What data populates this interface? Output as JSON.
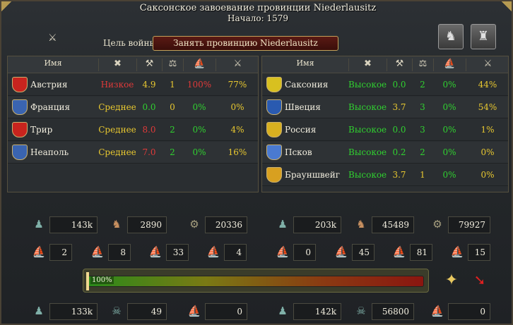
{
  "header": {
    "title": "Саксонское завоевание провинции Niederlausitz",
    "start": "Начало: 1579"
  },
  "war_goal": {
    "label": "Цель войны",
    "value": "Занять провинцию Niederlausitz"
  },
  "icons": {
    "crossed_swords": "crossed-swords-icon",
    "leaders": "leaders-icon",
    "advisors": "advisors-icon"
  },
  "table_headers": {
    "name": "Имя",
    "col2": "✖",
    "col3": "⚒",
    "col4": "⚖",
    "col5": "⛵",
    "col6": "⚔"
  },
  "attackers": [
    {
      "name": "Австрия",
      "status": "Низкое",
      "status_color": "r",
      "c1": "4.9",
      "c1_color": "y",
      "c2": "1",
      "c2_color": "y",
      "c3": "100%",
      "c3_color": "r",
      "c4": "77%",
      "c4_color": "y",
      "flag": "#c8241e"
    },
    {
      "name": "Франция",
      "status": "Среднее",
      "status_color": "y",
      "c1": "0.0",
      "c1_color": "g",
      "c2": "0",
      "c2_color": "y",
      "c3": "0%",
      "c3_color": "g",
      "c4": "0%",
      "c4_color": "y",
      "flag": "#3a64b0"
    },
    {
      "name": "Трир",
      "status": "Среднее",
      "status_color": "y",
      "c1": "8.0",
      "c1_color": "r",
      "c2": "2",
      "c2_color": "g",
      "c3": "0%",
      "c3_color": "g",
      "c4": "4%",
      "c4_color": "y",
      "flag": "#c8241e"
    },
    {
      "name": "Неаполь",
      "status": "Среднее",
      "status_color": "y",
      "c1": "7.0",
      "c1_color": "r",
      "c2": "2",
      "c2_color": "g",
      "c3": "0%",
      "c3_color": "g",
      "c4": "16%",
      "c4_color": "y",
      "flag": "#3a64b0"
    }
  ],
  "defenders": [
    {
      "name": "Саксония",
      "status": "Высокое",
      "status_color": "g",
      "c1": "0.0",
      "c1_color": "g",
      "c2": "2",
      "c2_color": "g",
      "c3": "0%",
      "c3_color": "g",
      "c4": "44%",
      "c4_color": "y",
      "flag": "#d8c020"
    },
    {
      "name": "Швеция",
      "status": "Высокое",
      "status_color": "g",
      "c1": "3.7",
      "c1_color": "y",
      "c2": "3",
      "c2_color": "g",
      "c3": "0%",
      "c3_color": "g",
      "c4": "54%",
      "c4_color": "y",
      "flag": "#2a5ab0"
    },
    {
      "name": "Россия",
      "status": "Высокое",
      "status_color": "g",
      "c1": "0.0",
      "c1_color": "g",
      "c2": "3",
      "c2_color": "g",
      "c3": "0%",
      "c3_color": "g",
      "c4": "1%",
      "c4_color": "y",
      "flag": "#d8b020"
    },
    {
      "name": "Псков",
      "status": "Высокое",
      "status_color": "g",
      "c1": "0.2",
      "c1_color": "g",
      "c2": "2",
      "c2_color": "g",
      "c3": "0%",
      "c3_color": "g",
      "c4": "0%",
      "c4_color": "y",
      "flag": "#4a7ad0"
    },
    {
      "name": "Брауншвейг",
      "status": "Высокое",
      "status_color": "g",
      "c1": "3.7",
      "c1_color": "y",
      "c2": "1",
      "c2_color": "y",
      "c3": "0%",
      "c3_color": "g",
      "c4": "0%",
      "c4_color": "y",
      "flag": "#d8a020"
    }
  ],
  "attacker_forces": {
    "infantry": "143k",
    "cavalry": "2890",
    "artillery": "20336",
    "heavy_ships": "2",
    "light_ships": "8",
    "galleys": "33",
    "transports": "4"
  },
  "defender_forces": {
    "infantry": "203k",
    "cavalry": "45489",
    "artillery": "79927",
    "heavy_ships": "0",
    "light_ships": "45",
    "galleys": "81",
    "transports": "15"
  },
  "war_score": {
    "label": "100%",
    "value": 100
  },
  "attacker_losses": {
    "infantry": "133k",
    "leaders": "49",
    "ships": "0"
  },
  "defender_losses": {
    "infantry": "142k",
    "leaders": "56800",
    "ships": "0"
  }
}
